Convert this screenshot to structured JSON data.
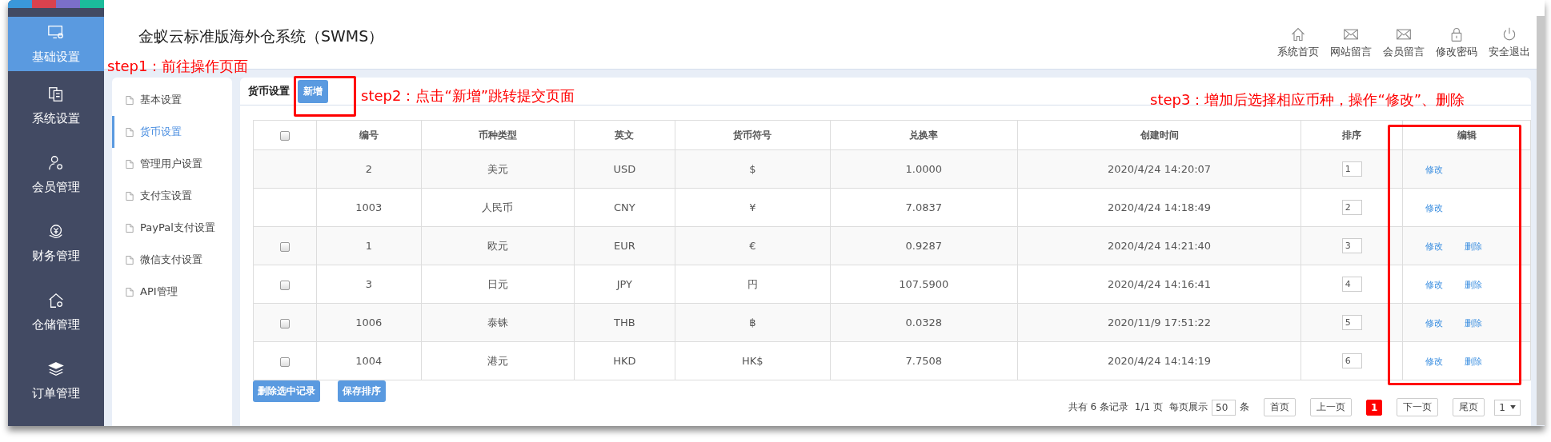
{
  "sidebar": {
    "items": [
      {
        "label": "基础设置",
        "selected": true
      },
      {
        "label": "系统设置",
        "selected": false
      },
      {
        "label": "会员管理",
        "selected": false
      },
      {
        "label": "财务管理",
        "selected": false
      },
      {
        "label": "仓储管理",
        "selected": false
      },
      {
        "label": "订单管理",
        "selected": false
      }
    ]
  },
  "header": {
    "title": "金蚁云标准版海外仓系统（SWMS）",
    "links": [
      {
        "label": "系统首页"
      },
      {
        "label": "网站留言"
      },
      {
        "label": "会员留言"
      },
      {
        "label": "修改密码"
      },
      {
        "label": "安全退出"
      }
    ]
  },
  "submenu": {
    "items": [
      {
        "label": "基本设置",
        "selected": false
      },
      {
        "label": "货币设置",
        "selected": true
      },
      {
        "label": "管理用户设置",
        "selected": false
      },
      {
        "label": "支付宝设置",
        "selected": false
      },
      {
        "label": "PayPal支付设置",
        "selected": false
      },
      {
        "label": "微信支付设置",
        "selected": false
      },
      {
        "label": "API管理",
        "selected": false
      }
    ]
  },
  "panel": {
    "title": "货币设置",
    "add_button": "新增"
  },
  "table": {
    "header_checked": false,
    "columns": [
      "编号",
      "币种类型",
      "英文",
      "货币符号",
      "兑换率",
      "创建时间",
      "排序",
      "编辑"
    ],
    "rows": [
      {
        "cells": [
          "2",
          "美元",
          "USD",
          "$",
          "1.0000",
          "2020/4/24 14:20:07"
        ],
        "sort": "1",
        "actions": [
          "修改"
        ]
      },
      {
        "cells": [
          "1003",
          "人民币",
          "CNY",
          "¥",
          "7.0837",
          "2020/4/24 14:18:49"
        ],
        "sort": "2",
        "actions": [
          "修改"
        ]
      },
      {
        "checked": false,
        "cells": [
          "1",
          "欧元",
          "EUR",
          "€",
          "0.9287",
          "2020/4/24 14:21:40"
        ],
        "sort": "3",
        "actions": [
          "修改",
          "删除"
        ]
      },
      {
        "checked": false,
        "cells": [
          "3",
          "日元",
          "JPY",
          "円",
          "107.5900",
          "2020/4/24 14:16:41"
        ],
        "sort": "4",
        "actions": [
          "修改",
          "删除"
        ]
      },
      {
        "checked": false,
        "cells": [
          "1006",
          "泰铢",
          "THB",
          "฿",
          "0.0328",
          "2020/11/9 17:51:22"
        ],
        "sort": "5",
        "actions": [
          "修改",
          "删除"
        ]
      },
      {
        "checked": false,
        "cells": [
          "1004",
          "港元",
          "HKD",
          "HK$",
          "7.7508",
          "2020/4/24 14:14:19"
        ],
        "sort": "6",
        "actions": [
          "修改",
          "删除"
        ]
      }
    ]
  },
  "buttons": [
    "删除选中记录",
    "保存排序"
  ],
  "pagination": {
    "total": "共有 6 条记录",
    "pages": "1/1 页",
    "per_page_label": "每页展示",
    "per_page": "50",
    "per_page_unit": "条",
    "nav": [
      {
        "label": "首页",
        "selected": false
      },
      {
        "label": "上一页",
        "selected": false
      },
      {
        "label": "1",
        "selected": true
      },
      {
        "label": "下一页",
        "selected": false
      },
      {
        "label": "尾页",
        "selected": false
      }
    ],
    "page_select": "1"
  },
  "annotations": [
    "step1：前往操作页面",
    "step2：点击“新增”跳转提交页面",
    "step3：增加后选择相应币种，操作“修改”、删除"
  ]
}
